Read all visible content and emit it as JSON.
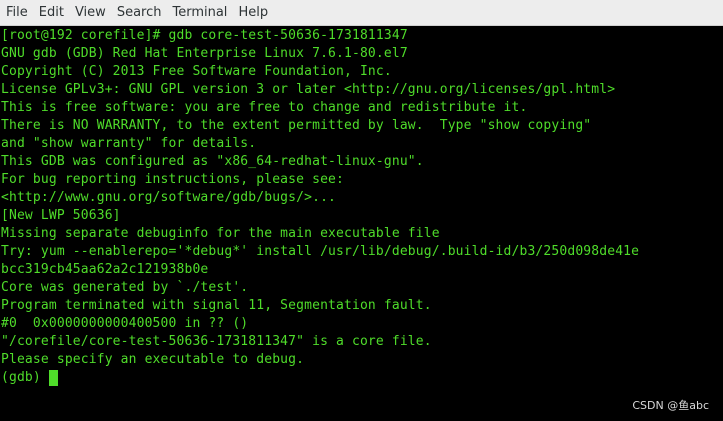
{
  "menubar": {
    "items": [
      "File",
      "Edit",
      "View",
      "Search",
      "Terminal",
      "Help"
    ]
  },
  "terminal": {
    "lines": [
      "[root@192 corefile]# gdb core-test-50636-1731811347",
      "GNU gdb (GDB) Red Hat Enterprise Linux 7.6.1-80.el7",
      "Copyright (C) 2013 Free Software Foundation, Inc.",
      "License GPLv3+: GNU GPL version 3 or later <http://gnu.org/licenses/gpl.html>",
      "This is free software: you are free to change and redistribute it.",
      "There is NO WARRANTY, to the extent permitted by law.  Type \"show copying\"",
      "and \"show warranty\" for details.",
      "This GDB was configured as \"x86_64-redhat-linux-gnu\".",
      "For bug reporting instructions, please see:",
      "<http://www.gnu.org/software/gdb/bugs/>...",
      "[New LWP 50636]",
      "Missing separate debuginfo for the main executable file",
      "Try: yum --enablerepo='*debug*' install /usr/lib/debug/.build-id/b3/250d098de41e",
      "bcc319cb45aa62a2c121938b0e",
      "Core was generated by `./test'.",
      "Program terminated with signal 11, Segmentation fault.",
      "#0  0x0000000000400500 in ?? ()",
      "\"/corefile/core-test-50636-1731811347\" is a core file.",
      "Please specify an executable to debug."
    ],
    "prompt": "(gdb)"
  },
  "watermark": "CSDN @鱼abc",
  "colors": {
    "terminal_text": "#4fdc2a",
    "terminal_background": "#000000",
    "menubar_background": "#ededed"
  }
}
